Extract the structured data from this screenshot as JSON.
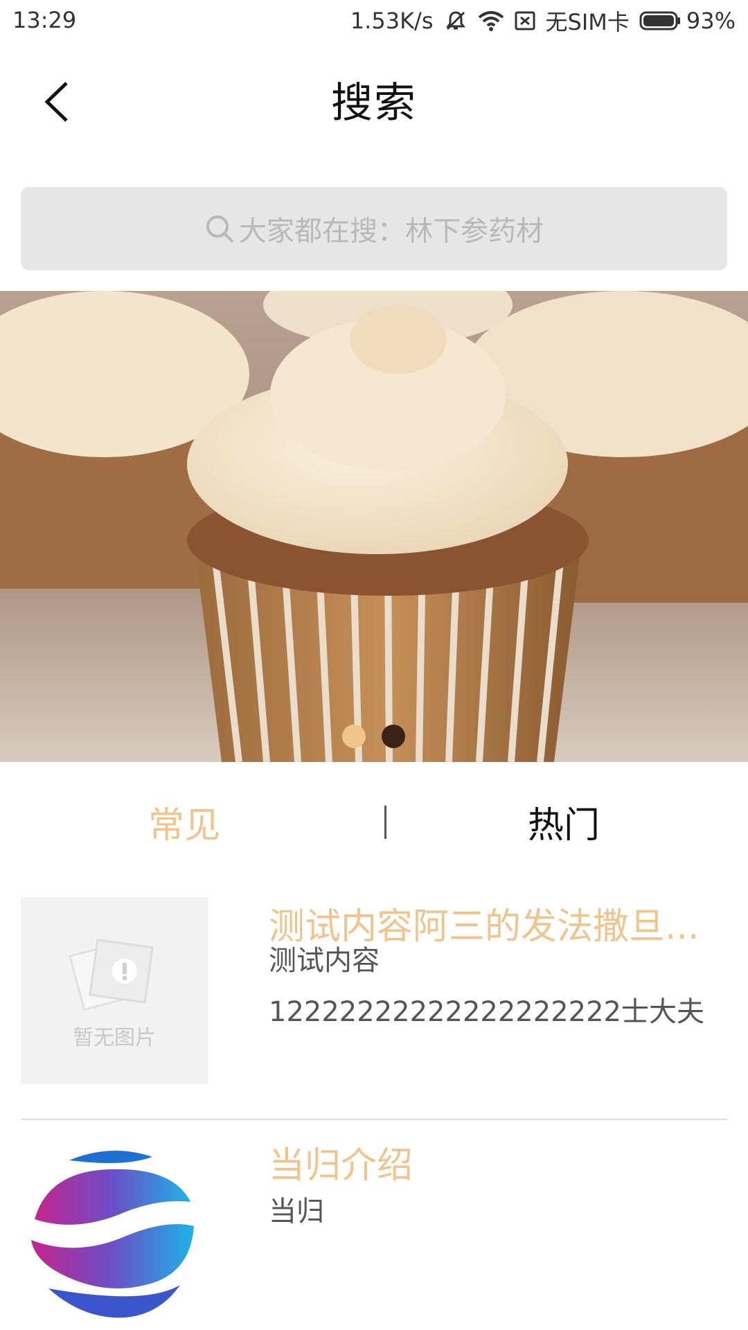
{
  "status_bar": {
    "time": "13:29",
    "net_speed": "1.53K/s",
    "sim": "无SIM卡",
    "battery": "93%",
    "icons": [
      "mute-icon",
      "wifi-icon",
      "no-sim-icon",
      "battery-icon"
    ]
  },
  "header": {
    "title": "搜索",
    "back_icon": "chevron-left-icon"
  },
  "search": {
    "placeholder": "大家都在搜：林下参药材",
    "icon": "search-icon"
  },
  "banner": {
    "image": "cupcake-photo",
    "slide_count": 2,
    "active_slide": 1
  },
  "tabs": [
    {
      "label": "常见",
      "active": true
    },
    {
      "label": "热门",
      "active": false
    }
  ],
  "list": [
    {
      "thumb": "no-image-placeholder",
      "thumb_text": "暂无图片",
      "title": "测试内容阿三的发法撒旦...",
      "desc_line1": "测试内容",
      "desc_line2": "12222222222222222222士大夫"
    },
    {
      "thumb": "globe-logo",
      "title": "当归介绍",
      "desc_line1": "当归"
    }
  ],
  "colors": {
    "accent": "#f2c48d",
    "search_bg": "#e6e6e6",
    "divider": "#dddddd"
  }
}
